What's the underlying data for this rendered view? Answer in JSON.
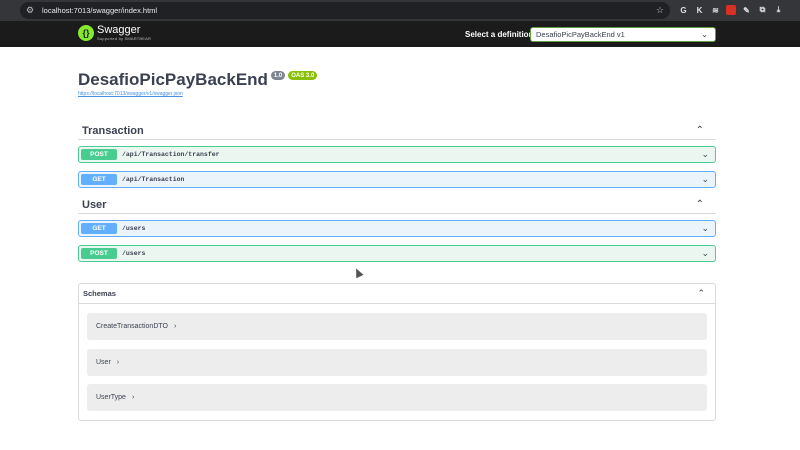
{
  "browser": {
    "url": "localhost:7013/swagger/index.html",
    "extensions": [
      "G",
      "K",
      "≋",
      "▪",
      "✎",
      "⧉"
    ]
  },
  "topbar": {
    "logo_name": "Swagger",
    "logo_sub": "Supported by SMARTBEAR",
    "definition_label": "Select a definition",
    "definition_value": "DesafioPicPayBackEnd v1"
  },
  "info": {
    "title": "DesafioPicPayBackEnd",
    "version": "1.0",
    "oas": "OAS 3.0",
    "spec_url": "https://localhost:7013/swagger/v1/swagger.json"
  },
  "tags": [
    {
      "name": "Transaction",
      "operations": [
        {
          "method": "POST",
          "path": "/api/Transaction/transfer"
        },
        {
          "method": "GET",
          "path": "/api/Transaction"
        }
      ]
    },
    {
      "name": "User",
      "operations": [
        {
          "method": "GET",
          "path": "/users"
        },
        {
          "method": "POST",
          "path": "/users"
        }
      ]
    }
  ],
  "schemas": {
    "title": "Schemas",
    "models": [
      "CreateTransactionDTO",
      "User",
      "UserType"
    ]
  },
  "colors": {
    "post": "#49cc90",
    "get": "#61affe",
    "topbar": "#1b1b1b",
    "oas_badge": "#89bf04"
  }
}
